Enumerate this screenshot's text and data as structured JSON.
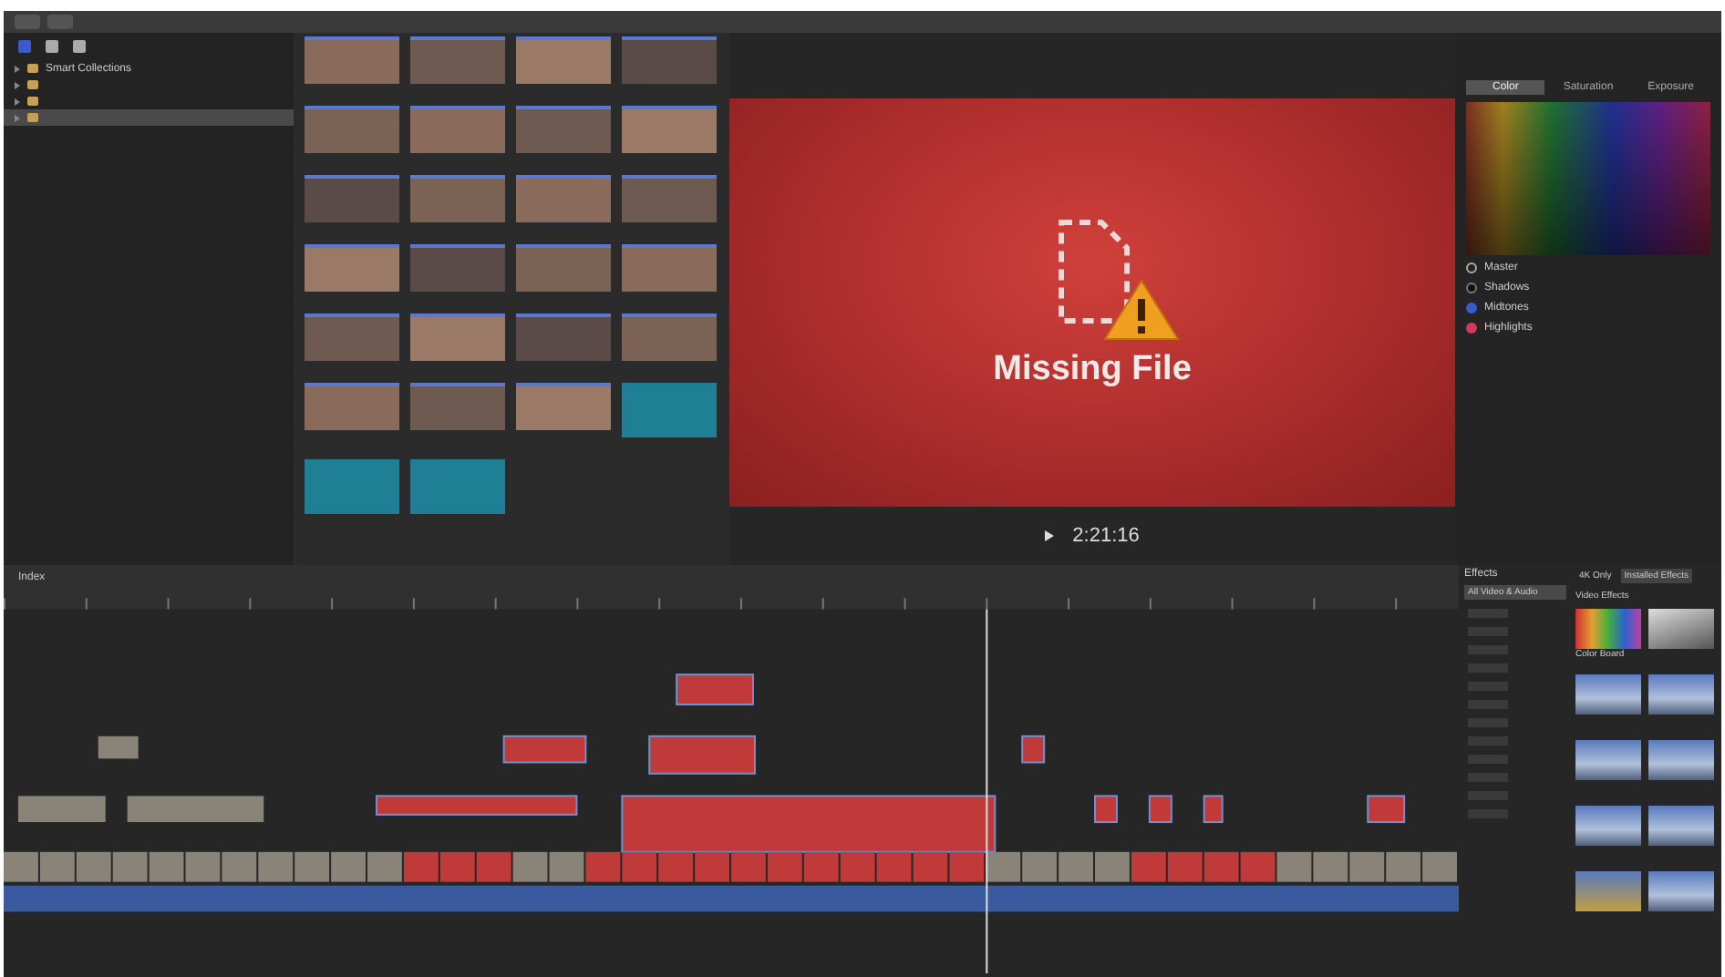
{
  "library": {
    "items": [
      {
        "label": "Smart Collections",
        "selected": false
      },
      {
        "selected": false
      },
      {
        "selected": false
      },
      {
        "selected": true
      }
    ]
  },
  "browser": {
    "clips": [
      {
        "kind": "photo"
      },
      {
        "kind": "photo"
      },
      {
        "kind": "photo"
      },
      {
        "kind": "photo"
      },
      {
        "kind": "photo"
      },
      {
        "kind": "photo"
      },
      {
        "kind": "photo"
      },
      {
        "kind": "photo"
      },
      {
        "kind": "photo"
      },
      {
        "kind": "photo"
      },
      {
        "kind": "photo"
      },
      {
        "kind": "photo"
      },
      {
        "kind": "photo"
      },
      {
        "kind": "photo"
      },
      {
        "kind": "photo"
      },
      {
        "kind": "photo"
      },
      {
        "kind": "photo"
      },
      {
        "kind": "photo"
      },
      {
        "kind": "photo"
      },
      {
        "kind": "photo"
      },
      {
        "kind": "photo"
      },
      {
        "kind": "photo"
      },
      {
        "kind": "photo"
      },
      {
        "kind": "generator"
      },
      {
        "kind": "generator"
      },
      {
        "kind": "generator"
      }
    ]
  },
  "viewer": {
    "message": "Missing File",
    "timecode": "2:21:16"
  },
  "inspector": {
    "tabs": [
      {
        "label": "Color",
        "selected": true
      },
      {
        "label": "Saturation",
        "selected": false
      },
      {
        "label": "Exposure",
        "selected": false
      }
    ],
    "rows": [
      {
        "label": "Master",
        "kind": "ring"
      },
      {
        "label": "Shadows",
        "kind": "dark"
      },
      {
        "label": "Midtones",
        "kind": "mid"
      },
      {
        "label": "Highlights",
        "kind": "high"
      }
    ]
  },
  "timeline": {
    "index_label": "Index"
  },
  "effects": {
    "title": "Effects",
    "tabs": [
      {
        "label": "4K Only",
        "selected": false
      },
      {
        "label": "Installed Effects",
        "selected": true
      }
    ],
    "categories": [
      {
        "label": "All Video & Audio",
        "selected": true
      }
    ],
    "heading": "Video Effects",
    "items": [
      {
        "label": "Color Board",
        "kind": "rainbow"
      },
      {
        "kind": "mono"
      },
      {
        "kind": "sky"
      },
      {
        "kind": "sky"
      },
      {
        "kind": "sky"
      },
      {
        "kind": "sky"
      },
      {
        "kind": "sky"
      },
      {
        "kind": "sky"
      },
      {
        "kind": "ring"
      },
      {
        "kind": "sky"
      }
    ]
  }
}
